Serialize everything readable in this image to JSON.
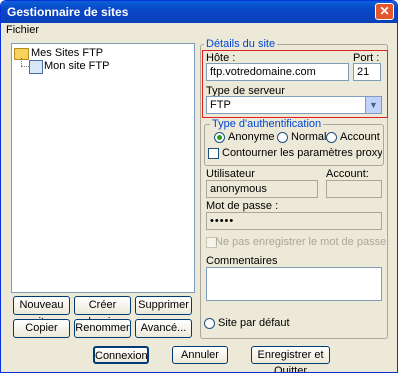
{
  "window": {
    "title": "Gestionnaire de sites",
    "close_glyph": "✕"
  },
  "menu": {
    "file": "Fichier"
  },
  "tree": {
    "root": "Mes Sites FTP",
    "child": "Mon site FTP"
  },
  "buttons": {
    "new_site": "Nouveau site",
    "new_folder": "Créer dossier",
    "delete": "Supprimer",
    "copy": "Copier",
    "rename": "Renommer",
    "advanced": "Avancé...",
    "connect": "Connexion",
    "cancel": "Annuler",
    "save_quit": "Enregistrer et Quitter"
  },
  "details": {
    "group_label": "Détails du site",
    "host_label": "Hôte :",
    "host_value": "ftp.votredomaine.com",
    "port_label": "Port :",
    "port_value": "21",
    "server_type_label": "Type de serveur",
    "server_type_value": "FTP"
  },
  "auth": {
    "group_label": "Type d'authentification",
    "anonymous": "Anonyme",
    "normal": "Normal",
    "account": "Account",
    "selected": "Anonyme",
    "bypass_proxy": "Contourner les paramètres proxy / pare-feu"
  },
  "credentials": {
    "user_label": "Utilisateur",
    "user_value": "anonymous",
    "account_label": "Account:",
    "account_value": "",
    "password_label": "Mot de passe :",
    "password_value": "•••••",
    "dont_save_password": "Ne pas enregistrer le mot de passe."
  },
  "comments": {
    "label": "Commentaires",
    "value": ""
  },
  "default_site": {
    "label": "Site par défaut"
  },
  "colors": {
    "titlebar": "#0847c6",
    "highlight": "#e02020",
    "group_label": "#0046d5"
  },
  "icons": {
    "close": "close-icon",
    "folder": "folder-icon",
    "site": "ftp-site-icon"
  }
}
